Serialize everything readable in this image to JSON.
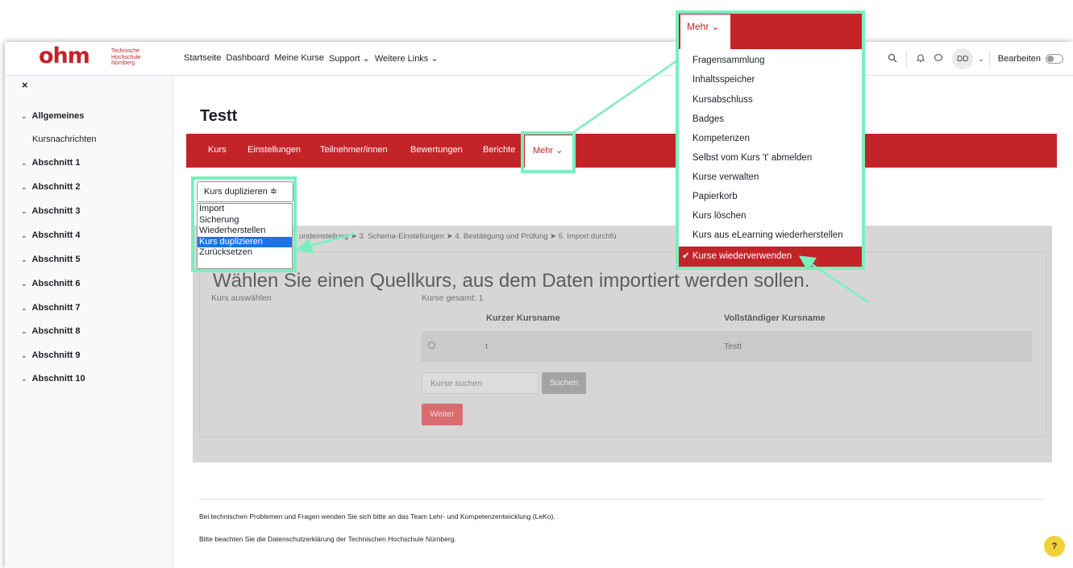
{
  "logo": {
    "name": "ohm",
    "sub_lines": [
      "Technische",
      "Hochschule",
      "Nürnberg"
    ]
  },
  "nav": {
    "links": [
      "Startseite",
      "Dashboard",
      "Meine Kurse",
      "Support ⌄",
      "Weitere Links ⌄"
    ],
    "avatar": "DD",
    "edit_label": "Bearbeiten"
  },
  "sidebar": {
    "close": "×",
    "allgemeines": "Allgemeines",
    "kursnachrichten": "Kursnachrichten",
    "sections": [
      "Abschnitt 1",
      "Abschnitt 2",
      "Abschnitt 3",
      "Abschnitt 4",
      "Abschnitt 5",
      "Abschnitt 6",
      "Abschnitt 7",
      "Abschnitt 8",
      "Abschnitt 9",
      "Abschnitt 10"
    ]
  },
  "course": {
    "title": "Testt",
    "tabs": [
      "Kurs",
      "Einstellungen",
      "Teilnehmer/innen",
      "Bewertungen",
      "Berichte"
    ],
    "mehr": "Mehr ⌄"
  },
  "dup_select": {
    "value": "Kurs duplizieren  ≑",
    "options": [
      "Import",
      "Sicherung",
      "Wiederherstellen",
      "Kurs duplizieren",
      "Zurücksetzen"
    ]
  },
  "import_page": {
    "breadcrumb": "undeinstellung ➤ 3. Schema-Einstellungen ➤ 4. Bestätigung und Prüfung ➤ 5. Import durchfü",
    "heading": "Wählen Sie einen Quellkurs, aus dem Daten importiert werden sollen.",
    "select_label": "Kurs auswählen",
    "total": "Kurse gesamt: 1",
    "col_short": "Kurzer Kursname",
    "col_full": "Vollständiger Kursname",
    "row_short": "t",
    "row_full": "Testt",
    "search_placeholder": "Kurse suchen",
    "search_button": "Suchen",
    "next_button": "Weiter"
  },
  "footer": {
    "line1": "Bei technischen Problemen und Fragen wenden Sie sich bitte an das Team Lehr- und Kompetenzentwicklung (LeKo).",
    "line2": "Bitte beachten Sie die Datenschutzerklärung der Technischen Hochschule Nürnberg.",
    "help": "?"
  },
  "mehr_menu": {
    "label": "Mehr ⌄",
    "items": [
      "Fragensammlung",
      "Inhaltsspeicher",
      "Kursabschluss",
      "Badges",
      "Kompetenzen",
      "Selbst vom Kurs 't' abmelden",
      "Kurse verwalten",
      "Papierkorb",
      "Kurs löschen",
      "Kurs aus eLearning wiederherstellen"
    ],
    "active": "✔ Kurse wiederverwenden"
  },
  "colors": {
    "brand": "#c2242a",
    "highlight": "#78f0be",
    "selection": "#1e73e8"
  }
}
